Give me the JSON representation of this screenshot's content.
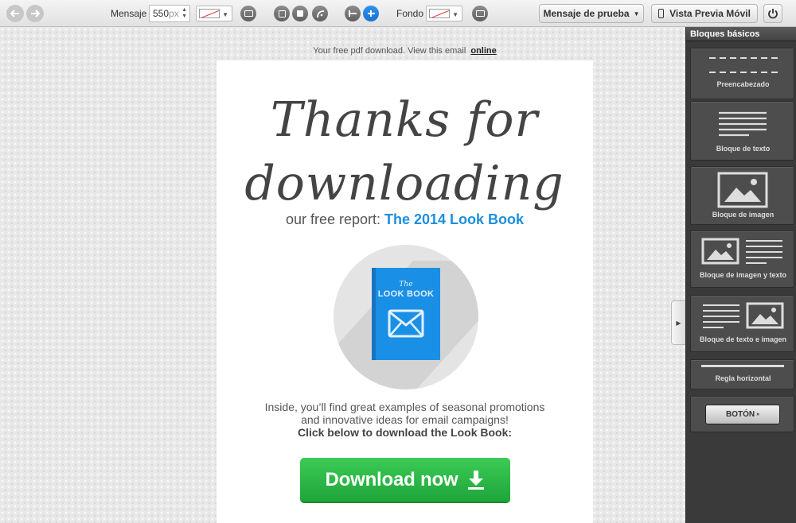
{
  "toolbar": {
    "undo_icon": "undo-arrow-icon",
    "redo_icon": "redo-arrow-icon",
    "message_label": "Mensaje",
    "width_value": "550",
    "width_unit": "px",
    "background_label": "Fondo",
    "test_message_label": "Mensaje de prueba",
    "mobile_preview_label": "Vista Previa Móvil",
    "power_icon": "power-icon"
  },
  "email": {
    "preheader_text": "Your free pdf download. View this email",
    "preheader_link": "online",
    "script_line1": "Thanks for",
    "script_line2": "downloading",
    "subtitle_prefix": "our free report:",
    "subtitle_report": "The 2014 Look Book",
    "book_the": "The",
    "book_title": "LOOK BOOK",
    "body_line1": "Inside, you’ll find great examples of seasonal promotions",
    "body_line2": "and innovative ideas for email campaigns!",
    "body_line3": "Click below to download the Look Book:",
    "download_label": "Download now"
  },
  "sidebar": {
    "title": "Bloques básicos",
    "blocks": [
      {
        "label": "Preencabezado"
      },
      {
        "label": "Bloque de texto"
      },
      {
        "label": "Bloque de imagen"
      },
      {
        "label": "Bloque de imagen y texto"
      },
      {
        "label": "Bloque de texto e imagen"
      },
      {
        "label": "Regla horizontal"
      },
      {
        "label": "BOTÓN"
      }
    ],
    "button_sup": "»"
  },
  "colors": {
    "accent_blue": "#1b8fe0",
    "download_green": "#2bb948",
    "sidebar_bg": "#3a3a3a"
  }
}
